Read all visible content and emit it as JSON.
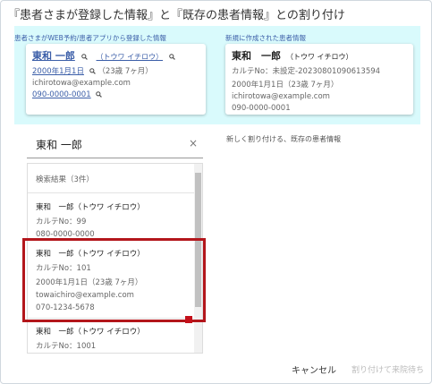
{
  "dialog": {
    "title": "『患者さまが登録した情報』と『既存の患者情報』との割り付け"
  },
  "registered": {
    "label": "患者さまがWEB予約/患者アプリから登録した情報",
    "name": "東和 一郎",
    "kana": "（トウワ イチロウ）",
    "birth": "2000年1月1日",
    "age": "（23歳 7ヶ月）",
    "email": "ichirotowa@example.com",
    "phone": "090-0000-0001"
  },
  "new_patient": {
    "label": "新規に作成された患者情報",
    "name": "東和　一郎",
    "kana": "（トウワ イチロウ）",
    "chart_no": "カルテNo：未設定-20230801090613594",
    "birth_age": "2000年1月1日（23歳 7ヶ月）",
    "email": "ichirotowa@example.com",
    "phone": "090-0000-0001"
  },
  "search": {
    "value": "東和 一郎",
    "clear": "×",
    "hint": "新しく割り付ける、既存の患者情報"
  },
  "results": {
    "count": "検索結果（3件）",
    "items": [
      {
        "name": "東和　一郎（トウワ イチロウ）",
        "chart": "カルテNo：99",
        "phone": "080-0000-0000"
      },
      {
        "name": "東和　一郎（トウワ イチロウ）",
        "chart": "カルテNo：101",
        "birth_age": "2000年1月1日（23歳 7ヶ月）",
        "email": "towaichiro@example.com",
        "phone": "070-1234-5678"
      },
      {
        "name": "東和　一郎（トウワ イチロウ）",
        "chart": "カルテNo：1001"
      }
    ]
  },
  "actions": {
    "cancel": "キャンセル",
    "assign": "割り付けて来院待ち"
  },
  "colors": {
    "panel_bg": "#d9fafc",
    "highlight": "#b3161b",
    "link": "#3b5ea8"
  }
}
